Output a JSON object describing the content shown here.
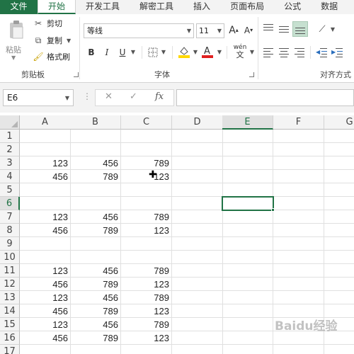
{
  "tabs": [
    {
      "label": "文件",
      "kind": "file"
    },
    {
      "label": "开始",
      "kind": "active"
    },
    {
      "label": "开发工具",
      "kind": ""
    },
    {
      "label": "解密工具",
      "kind": ""
    },
    {
      "label": "插入",
      "kind": ""
    },
    {
      "label": "页面布局",
      "kind": ""
    },
    {
      "label": "公式",
      "kind": ""
    },
    {
      "label": "数据",
      "kind": ""
    }
  ],
  "ribbon": {
    "clipboard": {
      "paste_label": "粘贴",
      "cut_label": "剪切",
      "copy_label": "复制",
      "format_painter_label": "格式刷",
      "group_label": "剪贴板"
    },
    "font": {
      "font_name": "等线",
      "font_size": "11",
      "grow_label": "A",
      "shrink_label": "A",
      "bold_label": "B",
      "italic_label": "I",
      "underline_label": "U",
      "phonetic_label": "wén",
      "group_label": "字体",
      "font_color": "#e02020",
      "fill_color": "#ffd800"
    },
    "alignment": {
      "group_label": "对齐方式"
    }
  },
  "formula_bar": {
    "name_box": "E6",
    "dots": "⋮",
    "cancel_icon": "✕",
    "enter_icon": "✓",
    "fx_label": "fx",
    "formula_value": ""
  },
  "sheet": {
    "columns": [
      "A",
      "B",
      "C",
      "D",
      "E",
      "F",
      "G"
    ],
    "selected_column": "E",
    "selected_row": "6",
    "rows": [
      {
        "n": "1",
        "cells": [
          "",
          "",
          ""
        ]
      },
      {
        "n": "2",
        "cells": [
          "",
          "",
          ""
        ]
      },
      {
        "n": "3",
        "cells": [
          "123",
          "456",
          "789"
        ]
      },
      {
        "n": "4",
        "cells": [
          "456",
          "789",
          "123"
        ]
      },
      {
        "n": "5",
        "cells": [
          "",
          "",
          ""
        ]
      },
      {
        "n": "6",
        "cells": [
          "",
          "",
          ""
        ]
      },
      {
        "n": "7",
        "cells": [
          "123",
          "456",
          "789"
        ]
      },
      {
        "n": "8",
        "cells": [
          "456",
          "789",
          "123"
        ]
      },
      {
        "n": "9",
        "cells": [
          "",
          "",
          ""
        ]
      },
      {
        "n": "10",
        "cells": [
          "",
          "",
          ""
        ]
      },
      {
        "n": "11",
        "cells": [
          "123",
          "456",
          "789"
        ]
      },
      {
        "n": "12",
        "cells": [
          "456",
          "789",
          "123"
        ]
      },
      {
        "n": "13",
        "cells": [
          "123",
          "456",
          "789"
        ]
      },
      {
        "n": "14",
        "cells": [
          "456",
          "789",
          "123"
        ]
      },
      {
        "n": "15",
        "cells": [
          "123",
          "456",
          "789"
        ]
      },
      {
        "n": "16",
        "cells": [
          "456",
          "789",
          "123"
        ]
      },
      {
        "n": "17",
        "cells": [
          "",
          "",
          ""
        ]
      }
    ]
  },
  "watermark": "Baidu经验",
  "accent_color": "#217346"
}
